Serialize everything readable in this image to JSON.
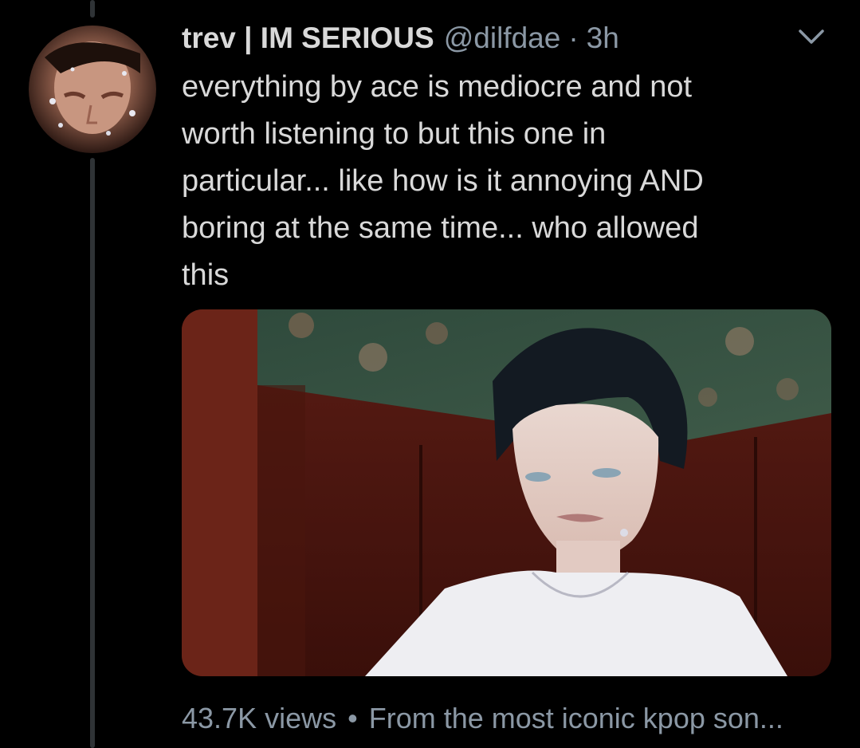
{
  "tweet": {
    "display_name": "trev | IM SERIOUS",
    "handle": "@dilfdae",
    "separator": "·",
    "time": "3h",
    "text": "everything by ace is mediocre and not\nworth listening to but this one in\nparticular... like how is it annoying AND\nboring at the same time... who allowed\nthis",
    "menu_icon": "chevron-down-icon",
    "video": {
      "views": "43.7K views",
      "dot": "•",
      "source": "From the most iconic kpop son..."
    }
  },
  "colors": {
    "background": "#000000",
    "text_primary": "#d9d9d9",
    "text_secondary": "#8b98a5",
    "thread_line": "#2f3336"
  }
}
